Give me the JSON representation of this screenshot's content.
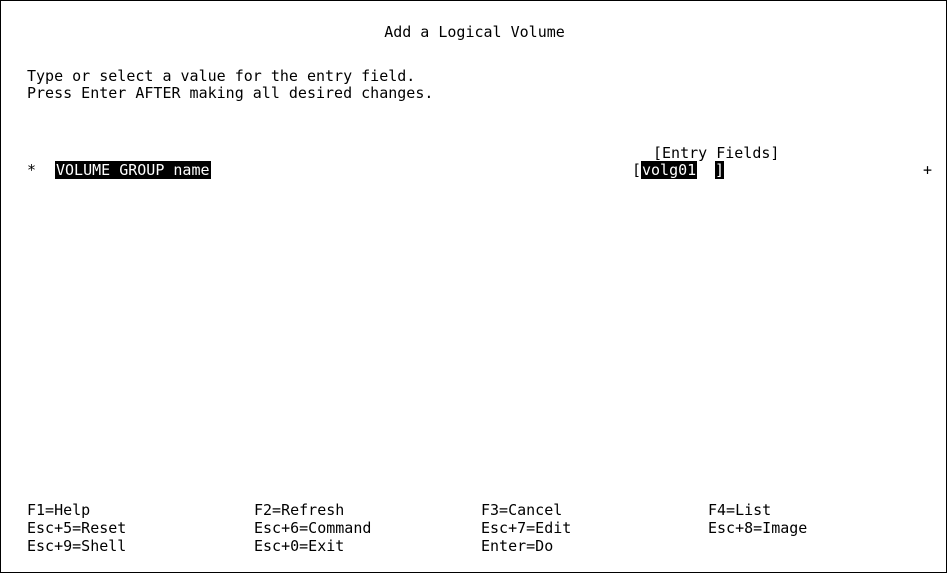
{
  "screen": {
    "title": "Add a Logical Volume",
    "instructions": [
      "Type or select a value for the entry field.",
      "Press Enter AFTER making all desired changes."
    ],
    "entry_fields_header": "[Entry Fields]"
  },
  "field": {
    "required_marker": "*",
    "label": "VOLUME GROUP name",
    "bracket_open": "[",
    "value": "volg01",
    "bracket_close": "]",
    "list_indicator": "+"
  },
  "function_keys": {
    "row1": [
      "F1=Help",
      "F2=Refresh",
      "F3=Cancel",
      "F4=List"
    ],
    "row2": [
      "Esc+5=Reset",
      "Esc+6=Command",
      "Esc+7=Edit",
      "Esc+8=Image"
    ],
    "row3": [
      "Esc+9=Shell",
      "Esc+0=Exit",
      "Enter=Do"
    ]
  },
  "colors": {
    "background": "#ffffff",
    "text": "#000000",
    "highlight_bg": "#000000",
    "highlight_text": "#ffffff"
  }
}
